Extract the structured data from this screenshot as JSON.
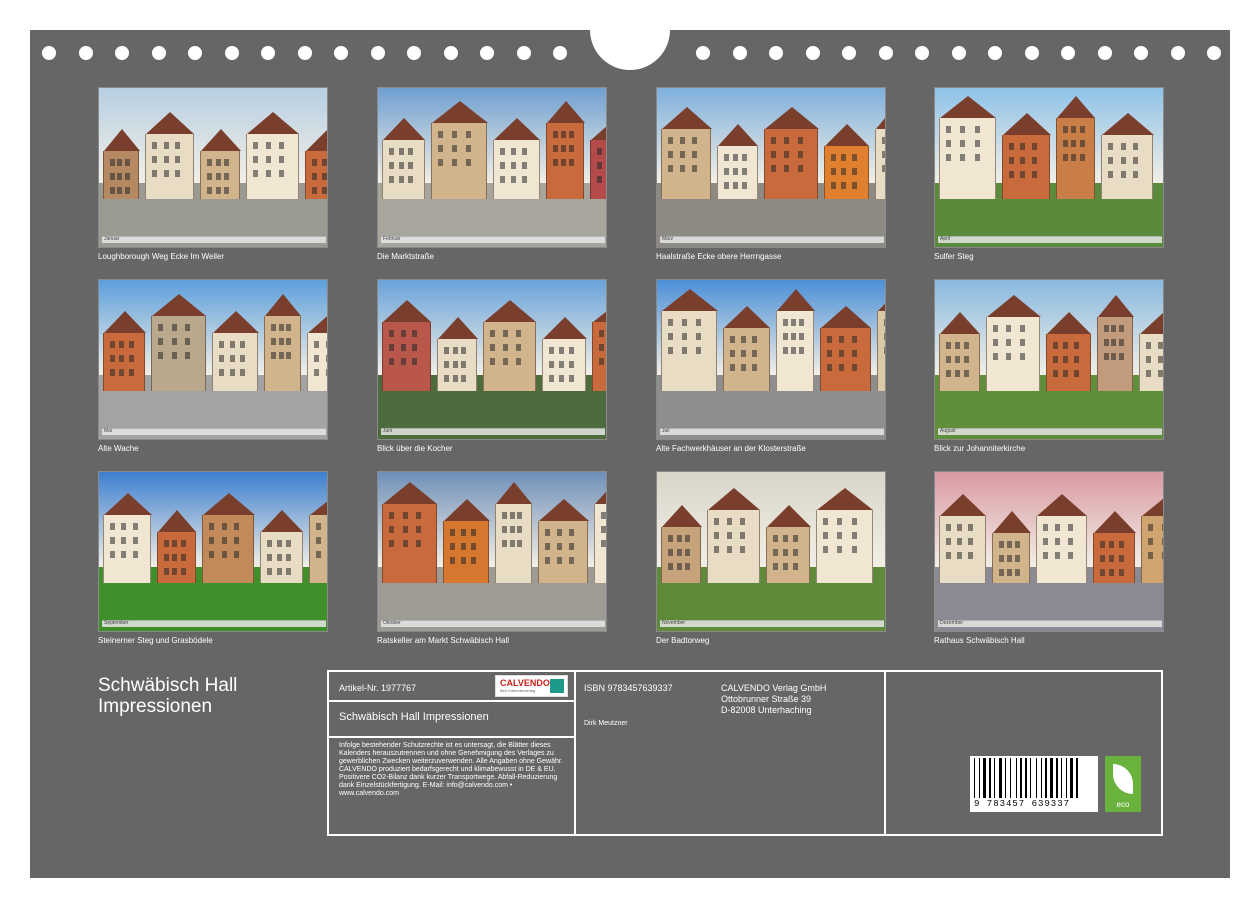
{
  "photos": [
    {
      "caption": "Loughborough Weg Ecke Im Weiler",
      "month": "Januar",
      "sky": "#b7cfe3",
      "ground": "#9a9a92",
      "accent": "#b58a63"
    },
    {
      "caption": "Die Marktstraße",
      "month": "Februar",
      "sky": "#6f9fd0",
      "ground": "#a8a59c",
      "accent": "#b44a4a"
    },
    {
      "caption": "Haalstraße Ecke obere Herrngasse",
      "month": "März",
      "sky": "#7fb0dc",
      "ground": "#8d8a83",
      "accent": "#e0802e"
    },
    {
      "caption": "Sulfer Steg",
      "month": "April",
      "sky": "#8fc2e8",
      "ground": "#5a8a3c",
      "accent": "#c97d47"
    },
    {
      "caption": "Alte Wache",
      "month": "Mai",
      "sky": "#5d9fdc",
      "ground": "#a3a3a3",
      "accent": "#b9a88b"
    },
    {
      "caption": "Blick über die Kocher",
      "month": "Juni",
      "sky": "#6aa3da",
      "ground": "#4d6b3c",
      "accent": "#b8574a"
    },
    {
      "caption": "Alte Fachwerkhäuser an der Klosterstraße",
      "month": "Juli",
      "sky": "#4b8fd8",
      "ground": "#8e8e8e",
      "accent": "#d9c9a7"
    },
    {
      "caption": "Blick zur Johanniterkirche",
      "month": "August",
      "sky": "#89b9e0",
      "ground": "#5f8f3a",
      "accent": "#c29b7c"
    },
    {
      "caption": "Steinerner Steg und Grasbödele",
      "month": "September",
      "sky": "#3d7fd0",
      "ground": "#3f8f2a",
      "accent": "#c28a5a"
    },
    {
      "caption": "Ratskeller am Markt Schwäbisch Hall",
      "month": "Oktober",
      "sky": "#6f8fb8",
      "ground": "#9d9b94",
      "accent": "#d5772f"
    },
    {
      "caption": "Der Badtorweg",
      "month": "November",
      "sky": "#d8d6c9",
      "ground": "#5f8a3a",
      "accent": "#c7a37c"
    },
    {
      "caption": "Rathaus Schwäbisch Hall",
      "month": "Dezember",
      "sky": "#d99aa3",
      "ground": "#8a8a94",
      "accent": "#cfa46e"
    }
  ],
  "title": {
    "line1": "Schwäbisch Hall",
    "line2": "Impressionen"
  },
  "info": {
    "article": "Artikel-Nr. 1977767",
    "logo": "CALVENDO",
    "logo_sub": "Birh Kalenderverlag",
    "product_title": "Schwäbisch Hall Impressionen",
    "legal": "Infolge bestehender Schutzrechte ist es untersagt, die Blätter dieses Kalenders herauszutrennen und ohne Genehmigung des Verlages zu gewerblichen Zwecken weiterzuverwenden. Alle Angaben ohne Gewähr. CALVENDO produziert bedarfsgerecht und klimabewusst in DE & EU. Positivere CO2-Bilanz dank kurzer Transportwege. Abfall-Reduzierung dank Einzelstückfertigung. E-Mail: info@calvendo.com • www.calvendo.com",
    "isbn": "ISBN 9783457639337",
    "author": "Dirk Meutzner",
    "publisher_name": "CALVENDO Verlag GmbH",
    "publisher_street": "Ottobrunner Straße 39",
    "publisher_city": "D-82008 Unterhaching",
    "barcode_number": "9 783457 639337",
    "eco_label": "eco"
  }
}
